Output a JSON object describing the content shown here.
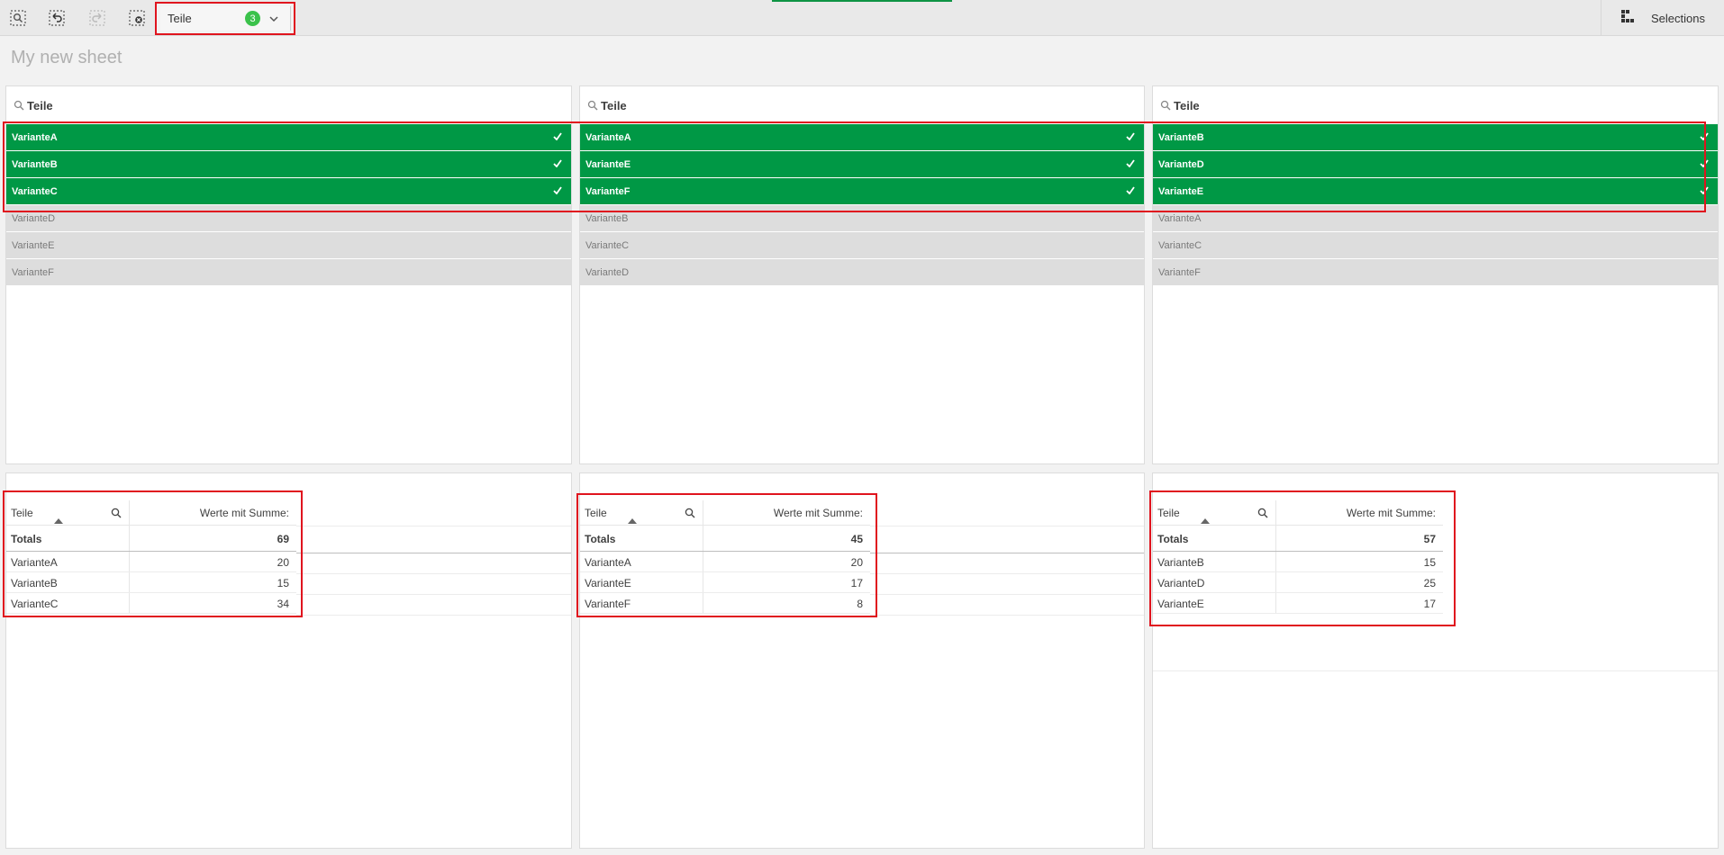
{
  "toolbar": {
    "selection_chip": {
      "field": "Teile",
      "count": "3"
    },
    "selections_label": "Selections"
  },
  "sheet_title": "My new sheet",
  "filters": [
    {
      "label": "Teile",
      "selected": [
        "VarianteA",
        "VarianteB",
        "VarianteC"
      ],
      "excluded": [
        "VarianteD",
        "VarianteE",
        "VarianteF"
      ]
    },
    {
      "label": "Teile",
      "selected": [
        "VarianteA",
        "VarianteE",
        "VarianteF"
      ],
      "excluded": [
        "VarianteB",
        "VarianteC",
        "VarianteD"
      ]
    },
    {
      "label": "Teile",
      "selected": [
        "VarianteB",
        "VarianteD",
        "VarianteE"
      ],
      "excluded": [
        "VarianteA",
        "VarianteC",
        "VarianteF"
      ]
    }
  ],
  "tables": [
    {
      "dim_header": "Teile",
      "measure_header": "Werte mit Summe:",
      "totals_label": "Totals",
      "totals_value": "69",
      "rows": [
        {
          "name": "VarianteA",
          "value": "20"
        },
        {
          "name": "VarianteB",
          "value": "15"
        },
        {
          "name": "VarianteC",
          "value": "34"
        }
      ]
    },
    {
      "dim_header": "Teile",
      "measure_header": "Werte mit Summe:",
      "totals_label": "Totals",
      "totals_value": "45",
      "rows": [
        {
          "name": "VarianteA",
          "value": "20"
        },
        {
          "name": "VarianteE",
          "value": "17"
        },
        {
          "name": "VarianteF",
          "value": "8"
        }
      ]
    },
    {
      "dim_header": "Teile",
      "measure_header": "Werte mit Summe:",
      "totals_label": "Totals",
      "totals_value": "57",
      "rows": [
        {
          "name": "VarianteB",
          "value": "15"
        },
        {
          "name": "VarianteD",
          "value": "25"
        },
        {
          "name": "VarianteE",
          "value": "17"
        }
      ]
    }
  ]
}
